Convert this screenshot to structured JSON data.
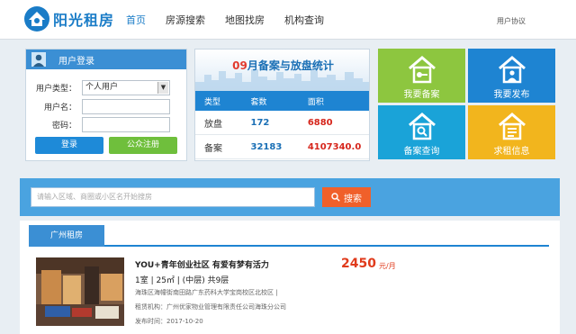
{
  "header": {
    "logo_text": "阳光租房",
    "nav": [
      "首页",
      "房源搜索",
      "地图找房",
      "机构查询"
    ],
    "active_nav": 0,
    "agreement": "用户协议"
  },
  "login": {
    "title": "用户登录",
    "type_label": "用户类型：",
    "type_value": "个人用户",
    "username_label": "用户名：",
    "password_label": "密码：",
    "login_button": "登录",
    "register_button": "公众注册"
  },
  "stats": {
    "month": "09",
    "title_rest": "月备案与放盘统计",
    "columns": [
      "类型",
      "套数",
      "面积"
    ],
    "rows": [
      {
        "type": "放盘",
        "count": "172",
        "area": "6880"
      },
      {
        "type": "备案",
        "count": "32183",
        "area": "4107340.0"
      }
    ]
  },
  "tiles": [
    {
      "label": "我要备案",
      "icon": "house-key-icon",
      "color": "#8dc63f"
    },
    {
      "label": "我要发布",
      "icon": "house-person-icon",
      "color": "#1e84d2"
    },
    {
      "label": "备案查询",
      "icon": "house-search-icon",
      "color": "#1aa3d8"
    },
    {
      "label": "求租信息",
      "icon": "house-list-icon",
      "color": "#f2b51d"
    }
  ],
  "search": {
    "placeholder": "请输入区域、商圈或小区名开始搜房",
    "button": "搜索"
  },
  "listings": {
    "tab": "广州租房",
    "items": [
      {
        "title": "YOU+青年创业社区 有爱有梦有活力",
        "spec": "1室 | 25㎡ | (中层) 共9层",
        "address": "海珠区海幢街南田路广东药科大学宝岗校区北校区 |",
        "agency": "租赁机构：广州优家物业管理有限责任公司海珠分公司",
        "date": "发布时间：2017-10-20",
        "price": "2450",
        "unit": "元/月"
      }
    ]
  }
}
